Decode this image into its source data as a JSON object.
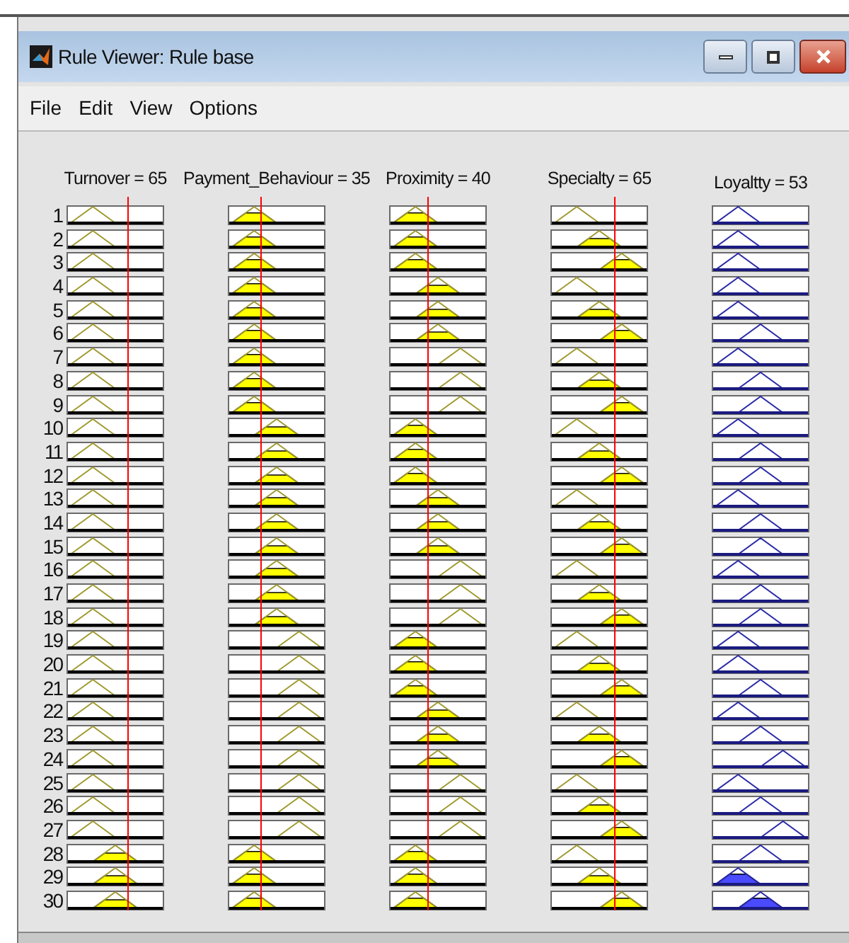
{
  "window": {
    "title": "Rule Viewer: Rule base"
  },
  "menu": [
    "File",
    "Edit",
    "View",
    "Options"
  ],
  "columns": [
    {
      "label": "Turnover = 65",
      "kind": "input"
    },
    {
      "label": "Payment_Behaviour = 35",
      "kind": "input"
    },
    {
      "label": "Proximity = 40",
      "kind": "input"
    },
    {
      "label": "Specialty = 65",
      "kind": "input"
    },
    {
      "label": "Loyaltty = 53",
      "kind": "output"
    }
  ],
  "rows": [
    {
      "number": "1",
      "cells": [
        {
          "kind": "low",
          "fired": false
        },
        {
          "kind": "low",
          "fired": true
        },
        {
          "kind": "low",
          "fired": true
        },
        {
          "kind": "low",
          "fired": false
        },
        {
          "kind": "low",
          "fired": false
        }
      ]
    },
    {
      "number": "2",
      "cells": [
        {
          "kind": "low",
          "fired": false
        },
        {
          "kind": "low",
          "fired": true
        },
        {
          "kind": "low",
          "fired": true
        },
        {
          "kind": "mid",
          "fired": true
        },
        {
          "kind": "low",
          "fired": false
        }
      ]
    },
    {
      "number": "3",
      "cells": [
        {
          "kind": "low",
          "fired": false
        },
        {
          "kind": "low",
          "fired": true
        },
        {
          "kind": "low",
          "fired": true
        },
        {
          "kind": "high",
          "fired": true
        },
        {
          "kind": "low",
          "fired": false
        }
      ]
    },
    {
      "number": "4",
      "cells": [
        {
          "kind": "low",
          "fired": false
        },
        {
          "kind": "low",
          "fired": true
        },
        {
          "kind": "mid",
          "fired": true
        },
        {
          "kind": "low",
          "fired": false
        },
        {
          "kind": "low",
          "fired": false
        }
      ]
    },
    {
      "number": "5",
      "cells": [
        {
          "kind": "low",
          "fired": false
        },
        {
          "kind": "low",
          "fired": true
        },
        {
          "kind": "mid",
          "fired": true
        },
        {
          "kind": "mid",
          "fired": true
        },
        {
          "kind": "low",
          "fired": false
        }
      ]
    },
    {
      "number": "6",
      "cells": [
        {
          "kind": "low",
          "fired": false
        },
        {
          "kind": "low",
          "fired": true
        },
        {
          "kind": "mid",
          "fired": true
        },
        {
          "kind": "high",
          "fired": true
        },
        {
          "kind": "mid",
          "fired": false
        }
      ]
    },
    {
      "number": "7",
      "cells": [
        {
          "kind": "low",
          "fired": false
        },
        {
          "kind": "low",
          "fired": true
        },
        {
          "kind": "high",
          "fired": false
        },
        {
          "kind": "low",
          "fired": false
        },
        {
          "kind": "low",
          "fired": false
        }
      ]
    },
    {
      "number": "8",
      "cells": [
        {
          "kind": "low",
          "fired": false
        },
        {
          "kind": "low",
          "fired": true
        },
        {
          "kind": "high",
          "fired": false
        },
        {
          "kind": "mid",
          "fired": true
        },
        {
          "kind": "mid",
          "fired": false
        }
      ]
    },
    {
      "number": "9",
      "cells": [
        {
          "kind": "low",
          "fired": false
        },
        {
          "kind": "low",
          "fired": true
        },
        {
          "kind": "high",
          "fired": false
        },
        {
          "kind": "high",
          "fired": true
        },
        {
          "kind": "mid",
          "fired": false
        }
      ]
    },
    {
      "number": "10",
      "cells": [
        {
          "kind": "low",
          "fired": false
        },
        {
          "kind": "mid",
          "fired": true
        },
        {
          "kind": "low",
          "fired": true
        },
        {
          "kind": "low",
          "fired": false
        },
        {
          "kind": "low",
          "fired": false
        }
      ]
    },
    {
      "number": "11",
      "cells": [
        {
          "kind": "low",
          "fired": false
        },
        {
          "kind": "mid",
          "fired": true
        },
        {
          "kind": "low",
          "fired": true
        },
        {
          "kind": "mid",
          "fired": true
        },
        {
          "kind": "mid",
          "fired": false
        }
      ]
    },
    {
      "number": "12",
      "cells": [
        {
          "kind": "low",
          "fired": false
        },
        {
          "kind": "mid",
          "fired": true
        },
        {
          "kind": "low",
          "fired": true
        },
        {
          "kind": "high",
          "fired": true
        },
        {
          "kind": "mid",
          "fired": false
        }
      ]
    },
    {
      "number": "13",
      "cells": [
        {
          "kind": "low",
          "fired": false
        },
        {
          "kind": "mid",
          "fired": true
        },
        {
          "kind": "mid",
          "fired": true
        },
        {
          "kind": "low",
          "fired": false
        },
        {
          "kind": "low",
          "fired": false
        }
      ]
    },
    {
      "number": "14",
      "cells": [
        {
          "kind": "low",
          "fired": false
        },
        {
          "kind": "mid",
          "fired": true
        },
        {
          "kind": "mid",
          "fired": true
        },
        {
          "kind": "mid",
          "fired": true
        },
        {
          "kind": "mid",
          "fired": false
        }
      ]
    },
    {
      "number": "15",
      "cells": [
        {
          "kind": "low",
          "fired": false
        },
        {
          "kind": "mid",
          "fired": true
        },
        {
          "kind": "mid",
          "fired": true
        },
        {
          "kind": "high",
          "fired": true
        },
        {
          "kind": "mid",
          "fired": false
        }
      ]
    },
    {
      "number": "16",
      "cells": [
        {
          "kind": "low",
          "fired": false
        },
        {
          "kind": "mid",
          "fired": true
        },
        {
          "kind": "high",
          "fired": false
        },
        {
          "kind": "low",
          "fired": false
        },
        {
          "kind": "low",
          "fired": false
        }
      ]
    },
    {
      "number": "17",
      "cells": [
        {
          "kind": "low",
          "fired": false
        },
        {
          "kind": "mid",
          "fired": true
        },
        {
          "kind": "high",
          "fired": false
        },
        {
          "kind": "mid",
          "fired": true
        },
        {
          "kind": "mid",
          "fired": false
        }
      ]
    },
    {
      "number": "18",
      "cells": [
        {
          "kind": "low",
          "fired": false
        },
        {
          "kind": "mid",
          "fired": true
        },
        {
          "kind": "high",
          "fired": false
        },
        {
          "kind": "high",
          "fired": true
        },
        {
          "kind": "mid",
          "fired": false
        }
      ]
    },
    {
      "number": "19",
      "cells": [
        {
          "kind": "low",
          "fired": false
        },
        {
          "kind": "high",
          "fired": false
        },
        {
          "kind": "low",
          "fired": true
        },
        {
          "kind": "low",
          "fired": false
        },
        {
          "kind": "low",
          "fired": false
        }
      ]
    },
    {
      "number": "20",
      "cells": [
        {
          "kind": "low",
          "fired": false
        },
        {
          "kind": "high",
          "fired": false
        },
        {
          "kind": "low",
          "fired": true
        },
        {
          "kind": "mid",
          "fired": true
        },
        {
          "kind": "low",
          "fired": false
        }
      ]
    },
    {
      "number": "21",
      "cells": [
        {
          "kind": "low",
          "fired": false
        },
        {
          "kind": "high",
          "fired": false
        },
        {
          "kind": "low",
          "fired": true
        },
        {
          "kind": "high",
          "fired": true
        },
        {
          "kind": "mid",
          "fired": false
        }
      ]
    },
    {
      "number": "22",
      "cells": [
        {
          "kind": "low",
          "fired": false
        },
        {
          "kind": "high",
          "fired": false
        },
        {
          "kind": "mid",
          "fired": true
        },
        {
          "kind": "low",
          "fired": false
        },
        {
          "kind": "low",
          "fired": false
        }
      ]
    },
    {
      "number": "23",
      "cells": [
        {
          "kind": "low",
          "fired": false
        },
        {
          "kind": "high",
          "fired": false
        },
        {
          "kind": "mid",
          "fired": true
        },
        {
          "kind": "mid",
          "fired": true
        },
        {
          "kind": "mid",
          "fired": false
        }
      ]
    },
    {
      "number": "24",
      "cells": [
        {
          "kind": "low",
          "fired": false
        },
        {
          "kind": "high",
          "fired": false
        },
        {
          "kind": "mid",
          "fired": true
        },
        {
          "kind": "high",
          "fired": true
        },
        {
          "kind": "high",
          "fired": false
        }
      ]
    },
    {
      "number": "25",
      "cells": [
        {
          "kind": "low",
          "fired": false
        },
        {
          "kind": "high",
          "fired": false
        },
        {
          "kind": "high",
          "fired": false
        },
        {
          "kind": "low",
          "fired": false
        },
        {
          "kind": "low",
          "fired": false
        }
      ]
    },
    {
      "number": "26",
      "cells": [
        {
          "kind": "low",
          "fired": false
        },
        {
          "kind": "high",
          "fired": false
        },
        {
          "kind": "high",
          "fired": false
        },
        {
          "kind": "mid",
          "fired": true
        },
        {
          "kind": "mid",
          "fired": false
        }
      ]
    },
    {
      "number": "27",
      "cells": [
        {
          "kind": "low",
          "fired": false
        },
        {
          "kind": "high",
          "fired": false
        },
        {
          "kind": "high",
          "fired": false
        },
        {
          "kind": "high",
          "fired": true
        },
        {
          "kind": "high",
          "fired": false
        }
      ]
    },
    {
      "number": "28",
      "cells": [
        {
          "kind": "mid",
          "fired": true
        },
        {
          "kind": "low",
          "fired": true
        },
        {
          "kind": "low",
          "fired": true
        },
        {
          "kind": "low",
          "fired": false
        },
        {
          "kind": "mid",
          "fired": false
        }
      ]
    },
    {
      "number": "29",
      "cells": [
        {
          "kind": "mid",
          "fired": true
        },
        {
          "kind": "low",
          "fired": true
        },
        {
          "kind": "low",
          "fired": true
        },
        {
          "kind": "mid",
          "fired": true
        },
        {
          "kind": "low",
          "fired": true
        }
      ]
    },
    {
      "number": "30",
      "cells": [
        {
          "kind": "mid",
          "fired": true
        },
        {
          "kind": "low",
          "fired": true
        },
        {
          "kind": "low",
          "fired": true
        },
        {
          "kind": "high",
          "fired": true
        },
        {
          "kind": "mid",
          "fired": true
        }
      ]
    }
  ]
}
